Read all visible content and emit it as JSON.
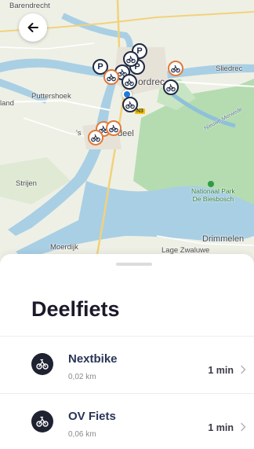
{
  "map": {
    "labels": {
      "barendrecht": "Barendrecht",
      "sliedrecht": "Sliedrec",
      "dordrecht": "ordrec",
      "puttershoek": "Puttershoek",
      "land": "land",
      "s": "'s",
      "deel": "deel",
      "strijen": "Strijen",
      "nieuwe_merwede": "Nieuwe Merwede",
      "park": "Nationaal Park\nDe Biesbosch",
      "drimmelen": "Drimmelen",
      "moerdijk": "Moerdijk",
      "lage_zwaluwe": "Lage Zwaluwe",
      "road_n3": "N3"
    },
    "pin_types": [
      "parking",
      "bike-dark",
      "bike-orange"
    ]
  },
  "back_icon": "arrow-left-icon",
  "sheet": {
    "title": "Deelfiets",
    "items": [
      {
        "name": "Nextbike",
        "distance": "0,02 km",
        "time": "1 min",
        "icon": "bike-icon"
      },
      {
        "name": "OV Fiets",
        "distance": "0,06 km",
        "time": "1 min",
        "icon": "bike-icon"
      }
    ]
  },
  "colors": {
    "accent_dark": "#1f2a44",
    "accent_orange": "#e07a3a",
    "water": "#a9cfe4",
    "green": "#b5dcb0"
  }
}
